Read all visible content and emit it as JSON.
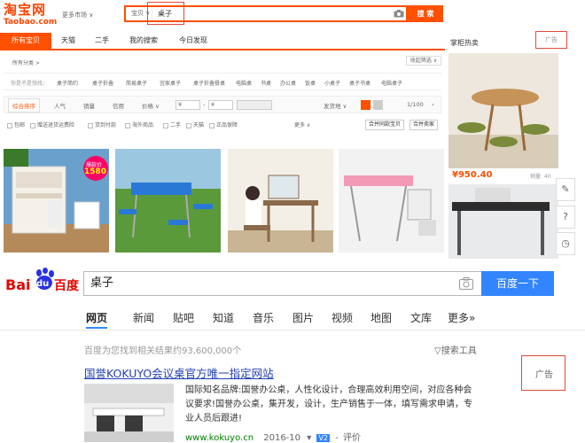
{
  "taobao": {
    "logo_main": "淘宝网",
    "logo_sub": "Taobao.com",
    "region": "更多市场 ∨",
    "search_scope": "宝贝 ∨",
    "search_query": "桌子",
    "search_button": "搜 索",
    "tabs": [
      "所有宝贝",
      "天猫",
      "二手",
      "我的搜索",
      "今日发现"
    ],
    "side_title": "掌柜热卖",
    "ad_label": "广告",
    "category_label": "所有分类 >",
    "filter_label": "收起筛选 ∨",
    "related_label": "你是不是想找：",
    "related": [
      "桌子简约",
      "桌子折叠",
      "简易桌子",
      "宜家桌子",
      "桌子折叠餐桌",
      "电脑桌",
      "书桌",
      "办公桌",
      "饭桌",
      "小桌子",
      "桌子书桌",
      "电脑桌子"
    ],
    "sort_items": [
      "综合排序",
      "人气",
      "销量",
      "信用",
      "价格 ∨",
      "¥",
      "-",
      "¥",
      "发货地 ∨",
      "1/100"
    ],
    "options": [
      "包邮",
      "赠送退货运费险",
      "货到付款",
      "海外商品",
      "二手",
      "天猫",
      "正品保障",
      "更多 ∨"
    ],
    "option_buttons": [
      "合并同款宝贝",
      "合并卖家"
    ],
    "product_badge_price": "1580",
    "product_badge_tag": "爆款价",
    "side_price": "¥950.40",
    "side_sales": "销量: 40",
    "side_tools": [
      "✎",
      "?",
      "◷"
    ]
  },
  "baidu": {
    "logo_text_1": "Bai",
    "logo_text_2": "du",
    "logo_text_3": "百度",
    "search_query": "桌子",
    "search_button": "百度一下",
    "tabs": [
      "网页",
      "新闻",
      "贴吧",
      "知道",
      "音乐",
      "图片",
      "视频",
      "地图",
      "文库",
      "更多»"
    ],
    "result_count": "百度为您找到相关结果约93,600,000个",
    "search_tools": "▽搜索工具",
    "ad_label": "广告",
    "result_title": "国誉KOKUYO会议桌官方唯一指定网站",
    "result_desc": "国际知名品牌:国誉办公桌，人性化设计，合理高效利用空间，对应各种会议要求!国誉办公桌，集开发，设计，生产销售于一体，填写需求申请，专业人员后跟进!",
    "result_url": "www.kokuyo.cn",
    "result_date": "2016-10",
    "result_v": "V2",
    "result_review": "评价"
  },
  "colors": {
    "taobao_orange": "#ff5000",
    "baidu_blue": "#3385ff",
    "link_blue": "#2440b3",
    "url_green": "#008000",
    "highlight_red": "#e04a3a"
  }
}
